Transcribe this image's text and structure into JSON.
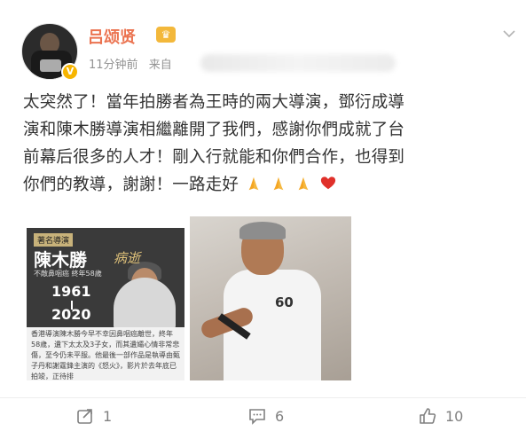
{
  "post": {
    "username": "吕颂贤",
    "time": "11分钟前",
    "from": "来自",
    "text_lines": [
      "太突然了！當年拍勝者為王時的兩大導演，鄧衍成導",
      "演和陳木勝導演相繼離開了我們，感謝你們成就了台",
      "前幕后很多的人才！剛入行就能和你們合作，也得到",
      "你們的教導，謝謝！一路走好"
    ]
  },
  "image1": {
    "tag": "著名導演",
    "name": "陳木勝",
    "died": "病逝",
    "sub": "不敵鼻咽癌 終年58歲",
    "year_start": "1961",
    "year_end": "2020",
    "caption": "香港導演陳木勝今早不幸因鼻咽癌離世，終年58歲，遺下太太及3子女，而其遺孀心情非常悲傷，至今仍未平服。他最後一部作品是執導由甄子丹和謝霆鋒主演的《怒火》，影片於去年底已拍竣，正待排"
  },
  "image2": {
    "shirt_number": "60"
  },
  "actions": {
    "share_count": "1",
    "comment_count": "6",
    "like_count": "10"
  },
  "colors": {
    "username": "#eb7350",
    "badge": "#f7b500",
    "meta": "#939393"
  }
}
